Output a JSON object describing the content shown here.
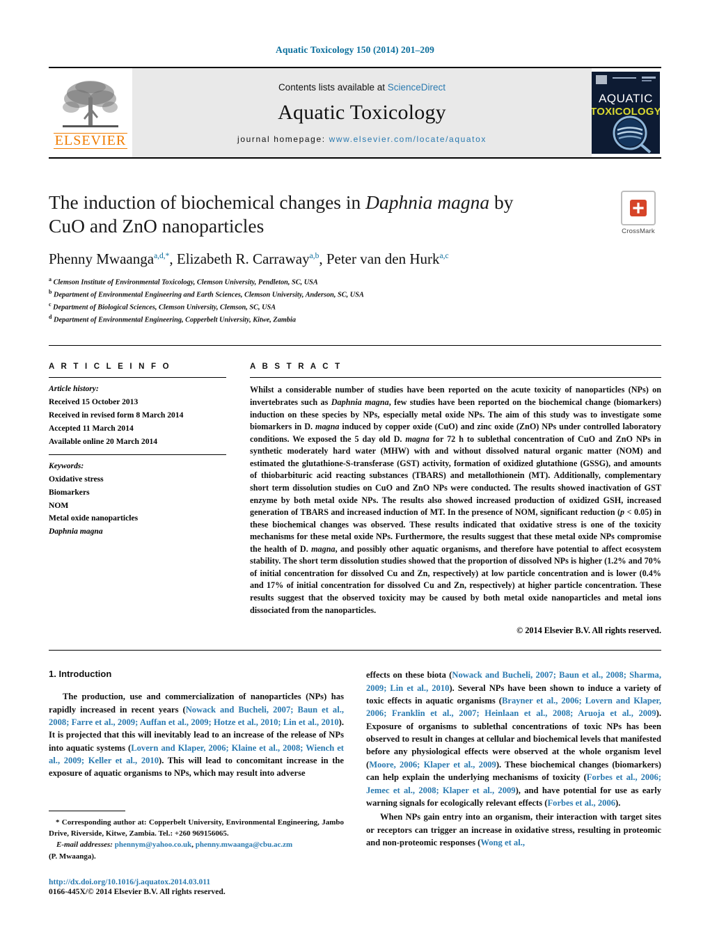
{
  "running_head": "Aquatic Toxicology 150 (2014) 201–209",
  "masthead": {
    "publisher_name": "ELSEVIER",
    "contents_prefix": "Contents lists available at ",
    "sciencedirect": "ScienceDirect",
    "journal_name": "Aquatic Toxicology",
    "homepage_prefix": "journal homepage: ",
    "homepage_url": "www.elsevier.com/locate/aquatox",
    "cover": {
      "line1": "AQUATIC",
      "line2": "TOXICOLOGY"
    }
  },
  "title": {
    "part1": "The induction of biochemical changes in ",
    "italic": "Daphnia magna",
    "part2": " by CuO and ZnO nanoparticles"
  },
  "crossmark": {
    "label": "CrossMark"
  },
  "authors": [
    {
      "name": "Phenny Mwaanga",
      "sup": "a,d,",
      "asterisk": "*"
    },
    {
      "name": "Elizabeth R. Carraway",
      "sup": "a,b"
    },
    {
      "name": "Peter van den Hurk",
      "sup": "a,c"
    }
  ],
  "affiliations": [
    {
      "mark": "a",
      "text": "Clemson Institute of Environmental Toxicology, Clemson University, Pendleton, SC, USA"
    },
    {
      "mark": "b",
      "text": "Department of Environmental Engineering and Earth Sciences, Clemson University, Anderson, SC, USA"
    },
    {
      "mark": "c",
      "text": "Department of Biological Sciences, Clemson University, Clemson, SC, USA"
    },
    {
      "mark": "d",
      "text": "Department of Environmental Engineering, Copperbelt University, Kitwe, Zambia"
    }
  ],
  "article_info": {
    "heading": "A R T I C L E   I N F O",
    "history_title": "Article history:",
    "history": [
      "Received 15 October 2013",
      "Received in revised form 8 March 2014",
      "Accepted 11 March 2014",
      "Available online 20 March 2014"
    ],
    "keywords_title": "Keywords:",
    "keywords": [
      "Oxidative stress",
      "Biomarkers",
      "NOM",
      "Metal oxide nanoparticles"
    ],
    "keyword_italic": "Daphnia magna"
  },
  "abstract": {
    "heading": "A B S T R A C T",
    "text_1": "Whilst a considerable number of studies have been reported on the acute toxicity of nanoparticles (NPs) on invertebrates such as ",
    "species_1": "Daphnia magna",
    "text_2": ", few studies have been reported on the biochemical change (biomarkers) induction on these species by NPs, especially metal oxide NPs. The aim of this study was to investigate some biomarkers in D. ",
    "species_2": "magna",
    "text_3": " induced by copper oxide (CuO) and zinc oxide (ZnO) NPs under controlled laboratory conditions. We exposed the 5 day old D. ",
    "species_3": "magna",
    "text_4": " for 72 h to sublethal concentration of CuO and ZnO NPs in synthetic moderately hard water (MHW) with and without dissolved natural organic matter (NOM) and estimated the glutathione-S-transferase (GST) activity, formation of oxidized glutathione (GSSG), and amounts of thiobarbituric acid reacting substances (TBARS) and metallothionein (MT). Additionally, complementary short term dissolution studies on CuO and ZnO NPs were conducted. The results showed inactivation of GST enzyme by both metal oxide NPs. The results also showed increased production of oxidized GSH, increased generation of TBARS and increased induction of MT. In the presence of NOM, significant reduction (",
    "pvalue_italic": "p",
    "text_5": " < 0.05) in these biochemical changes was observed. These results indicated that oxidative stress is one of the toxicity mechanisms for these metal oxide NPs. Furthermore, the results suggest that these metal oxide NPs compromise the health of D. ",
    "species_4": "magna",
    "text_6": ", and possibly other aquatic organisms, and therefore have potential to affect ecosystem stability. The short term dissolution studies showed that the proportion of dissolved NPs is higher (1.2% and 70% of initial concentration for dissolved Cu and Zn, respectively) at low particle concentration and is lower (0.4% and 17% of initial concentration for dissolved Cu and Zn, respectively) at higher particle concentration. These results suggest that the observed toxicity may be caused by both metal oxide nanoparticles and metal ions dissociated from the nanoparticles.",
    "copyright": "© 2014 Elsevier B.V. All rights reserved."
  },
  "introduction": {
    "heading": "1.  Introduction",
    "left": {
      "p1_a": "The production, use and commercialization of nanoparticles (NPs) has rapidly increased in recent years (",
      "p1_ref1": "Nowack and Bucheli, 2007; Baun et al., 2008; Farre et al., 2009; Auffan et al., 2009; Hotze et al., 2010; Lin et al., 2010",
      "p1_b": "). It is projected that this will inevitably lead to an increase of the release of NPs into aquatic systems (",
      "p1_ref2": "Lovern and Klaper, 2006; Klaine et al., 2008; Wiench et al., 2009; Keller et al., 2010",
      "p1_c": "). This will lead to concomitant increase in the exposure of aquatic organisms to NPs, which may result into adverse"
    },
    "right": {
      "p1_d": "effects on these biota (",
      "p1_ref3": "Nowack and Bucheli, 2007; Baun et al., 2008; Sharma, 2009; Lin et al., 2010",
      "p1_e": "). Several NPs have been shown to induce a variety of toxic effects in aquatic organisms (",
      "p1_ref4": "Brayner et al., 2006; Lovern and Klaper, 2006; Franklin et al., 2007; Heinlaan et al., 2008; Aruoja et al., 2009",
      "p1_f": "). Exposure of organisms to sublethal concentrations of toxic NPs has been observed to result in changes at cellular and biochemical levels that manifested before any physiological effects were observed at the whole organism level (",
      "p1_ref5": "Moore, 2006; Klaper et al., 2009",
      "p1_g": "). These biochemical changes (biomarkers) can help explain the underlying mechanisms of toxicity (",
      "p1_ref6": "Forbes et al., 2006; Jemec et al., 2008; Klaper et al., 2009",
      "p1_h": "), and have potential for use as early warning signals for ecologically relevant effects (",
      "p1_ref7": "Forbes et al., 2006",
      "p1_i": ").",
      "p2_a": "When NPs gain entry into an organism, their interaction with target sites or receptors can trigger an increase in oxidative stress, resulting in proteomic and non-proteomic responses (",
      "p2_ref1": "Wong et al.,"
    }
  },
  "footnotes": {
    "corresponding_marker": "*",
    "corresponding_text": " Corresponding author at: Copperbelt University, Environmental Engineering, Jambo Drive, Riverside, Kitwe, Zambia. Tel.: +260 969156065.",
    "email_label": "E-mail addresses:",
    "email_1": "phennym@yahoo.co.uk",
    "email_sep": ", ",
    "email_2": "phenny.mwaanga@cbu.ac.zm",
    "email_author": "(P. Mwaanga).",
    "doi": "http://dx.doi.org/10.1016/j.aquatox.2014.03.011",
    "issn": "0166-445X/© 2014 Elsevier B.V. All rights reserved."
  },
  "colors": {
    "link_blue": "#2a7ab0",
    "header_blue": "#0b6e9c",
    "elsevier_orange": "#F07C00",
    "band_gray": "#e9e9e9"
  }
}
